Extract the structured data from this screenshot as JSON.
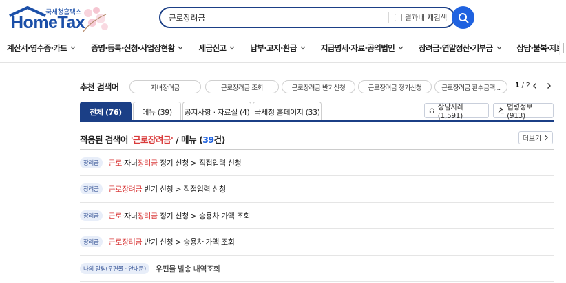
{
  "logo": {
    "sub": "국세청홈택스",
    "main": "HomeTax"
  },
  "search": {
    "value": "근로장려금",
    "placeholder": "",
    "research_label": "결과내 재검색"
  },
  "nav": [
    "계산서·영수증·카드",
    "증명·등록·신청·사업장현황",
    "세금신고",
    "납부·고지·환급",
    "지급명세·자료·공익법인",
    "장려금·연말정산·기부금",
    "상담·불복·제보",
    "세"
  ],
  "recommend": {
    "title": "추천 검색어",
    "chips": [
      "자녀장려금",
      "근로장려금 조회",
      "근로장려금 반기신청",
      "근로장려금 정기신청",
      "근로장려금 환수금액..."
    ],
    "page_current": "1",
    "page_total": " / 2"
  },
  "tabs": [
    {
      "label": "전체 (76)",
      "active": true
    },
    {
      "label": "메뉴 (39)",
      "active": false
    },
    {
      "label": "공지사항 · 자료실 (4)",
      "active": false
    },
    {
      "label": "국세청 홈페이지 (33)",
      "active": false
    }
  ],
  "side_buttons": [
    {
      "label": "상담사례 (1,591)",
      "icon": "headset-icon"
    },
    {
      "label": "법령정보 (913)",
      "icon": "gavel-icon"
    }
  ],
  "result_header": {
    "prefix": "적용된 검색어 ",
    "keyword": "'근로장려금'",
    "middle": " / 메뉴 (",
    "count": "39",
    "suffix": "건)"
  },
  "more_label": "더보기",
  "rows": [
    {
      "badge": "장려금",
      "parts": [
        {
          "t": "근로",
          "hl": true
        },
        {
          "t": "·자녀",
          "hl": false
        },
        {
          "t": "장려금",
          "hl": true
        },
        {
          "t": " 정기 신청 > 직접입력 신청",
          "hl": false
        }
      ]
    },
    {
      "badge": "장려금",
      "parts": [
        {
          "t": "근로장려금",
          "hl": true
        },
        {
          "t": " 반기 신청 > 직접입력 신청",
          "hl": false
        }
      ]
    },
    {
      "badge": "장려금",
      "parts": [
        {
          "t": "근로",
          "hl": true
        },
        {
          "t": "·자녀",
          "hl": false
        },
        {
          "t": "장려금",
          "hl": true
        },
        {
          "t": " 정기 신청 > 승용차 가액 조회",
          "hl": false
        }
      ]
    },
    {
      "badge": "장려금",
      "parts": [
        {
          "t": "근로장려금",
          "hl": true
        },
        {
          "t": " 반기 신청 > 승용차 가액 조회",
          "hl": false
        }
      ]
    },
    {
      "badge": "나의 알림(우편물 · 안내문)",
      "parts": [
        {
          "t": "우편물 발송 내역조회",
          "hl": false
        }
      ]
    }
  ],
  "colors": {
    "brand": "#1b3f86",
    "accent": "#1f62e0",
    "highlight": "#d93b3b"
  }
}
